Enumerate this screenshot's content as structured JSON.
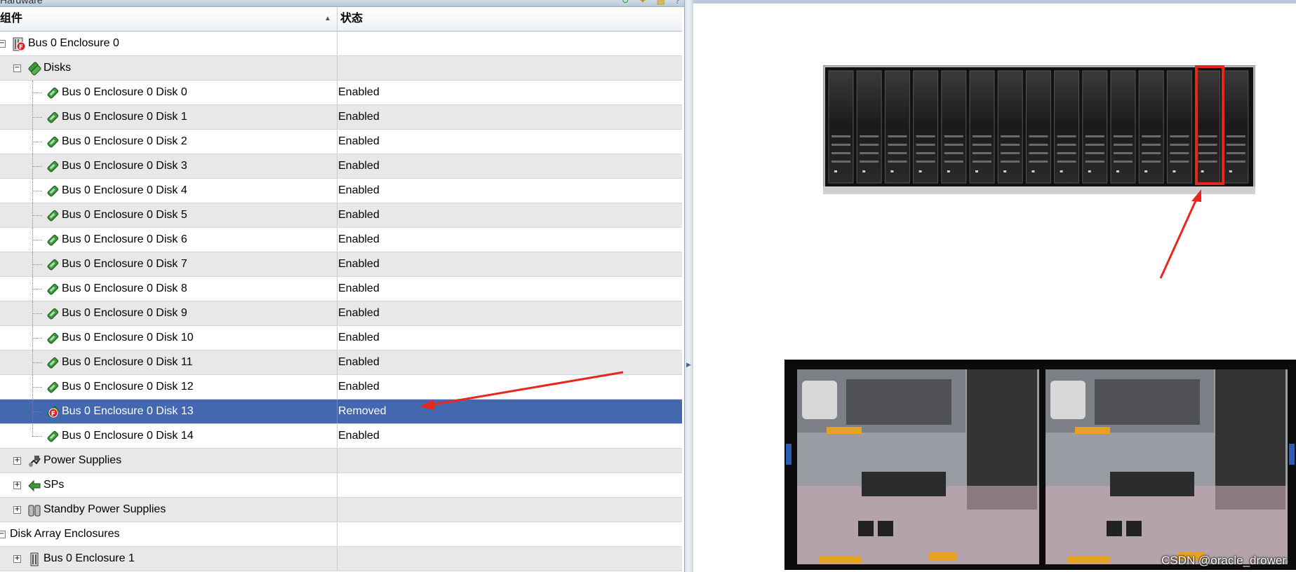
{
  "window": {
    "title": "Hardware"
  },
  "table": {
    "columns": {
      "component": "组件",
      "status": "状态"
    },
    "rows": [
      {
        "label": "Bus 0 Enclosure 0",
        "status": "",
        "level": 0,
        "expander": "minus",
        "icon": "enclosure-fault-icon"
      },
      {
        "label": "Disks",
        "status": "",
        "level": 1,
        "expander": "minus",
        "icon": "disks-group-icon"
      },
      {
        "label": "Bus 0 Enclosure 0 Disk 0",
        "status": "Enabled",
        "level": 2,
        "icon": "disk-icon"
      },
      {
        "label": "Bus 0 Enclosure 0 Disk 1",
        "status": "Enabled",
        "level": 2,
        "icon": "disk-icon"
      },
      {
        "label": "Bus 0 Enclosure 0 Disk 2",
        "status": "Enabled",
        "level": 2,
        "icon": "disk-icon"
      },
      {
        "label": "Bus 0 Enclosure 0 Disk 3",
        "status": "Enabled",
        "level": 2,
        "icon": "disk-icon"
      },
      {
        "label": "Bus 0 Enclosure 0 Disk 4",
        "status": "Enabled",
        "level": 2,
        "icon": "disk-icon"
      },
      {
        "label": "Bus 0 Enclosure 0 Disk 5",
        "status": "Enabled",
        "level": 2,
        "icon": "disk-icon"
      },
      {
        "label": "Bus 0 Enclosure 0 Disk 6",
        "status": "Enabled",
        "level": 2,
        "icon": "disk-icon"
      },
      {
        "label": "Bus 0 Enclosure 0 Disk 7",
        "status": "Enabled",
        "level": 2,
        "icon": "disk-icon"
      },
      {
        "label": "Bus 0 Enclosure 0 Disk 8",
        "status": "Enabled",
        "level": 2,
        "icon": "disk-icon"
      },
      {
        "label": "Bus 0 Enclosure 0 Disk 9",
        "status": "Enabled",
        "level": 2,
        "icon": "disk-icon"
      },
      {
        "label": "Bus 0 Enclosure 0 Disk 10",
        "status": "Enabled",
        "level": 2,
        "icon": "disk-icon"
      },
      {
        "label": "Bus 0 Enclosure 0 Disk 11",
        "status": "Enabled",
        "level": 2,
        "icon": "disk-icon"
      },
      {
        "label": "Bus 0 Enclosure 0 Disk 12",
        "status": "Enabled",
        "level": 2,
        "icon": "disk-icon"
      },
      {
        "label": "Bus 0 Enclosure 0 Disk 13",
        "status": "Removed",
        "level": 2,
        "icon": "disk-fault-icon",
        "selected": true
      },
      {
        "label": "Bus 0 Enclosure 0 Disk 14",
        "status": "Enabled",
        "level": 2,
        "icon": "disk-icon"
      },
      {
        "label": "Power Supplies",
        "status": "",
        "level": 1,
        "expander": "plus",
        "icon": "power-supply-icon"
      },
      {
        "label": "SPs",
        "status": "",
        "level": 1,
        "expander": "plus",
        "icon": "sp-icon"
      },
      {
        "label": "Standby Power Supplies",
        "status": "",
        "level": 1,
        "expander": "plus",
        "icon": "standby-power-icon"
      },
      {
        "label": "Disk Array Enclosures",
        "status": "",
        "level": 0,
        "expander": "minus",
        "icon": ""
      },
      {
        "label": "Bus 0 Enclosure 1",
        "status": "",
        "level": 1,
        "expander": "plus",
        "icon": "enclosure-icon"
      }
    ]
  },
  "colors": {
    "selection": "#4468b0",
    "alt_row": "#e8e8e8",
    "annotation": "#e8261c"
  },
  "watermark": "CSDN @oracle_drower"
}
